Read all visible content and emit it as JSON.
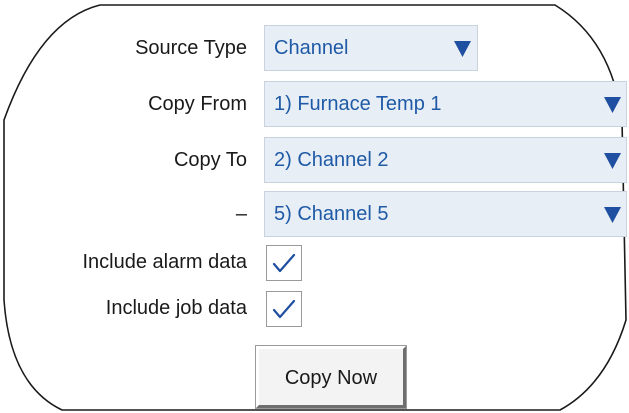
{
  "form": {
    "source_type": {
      "label": "Source Type",
      "value": "Channel"
    },
    "copy_from": {
      "label": "Copy From",
      "value": "1) Furnace Temp 1"
    },
    "copy_to": {
      "label": "Copy To",
      "value": "2) Channel 2"
    },
    "copy_to_end": {
      "label": "–",
      "value": "5) Channel 5"
    },
    "include_alarm_data": {
      "label": "Include alarm data",
      "checked": true
    },
    "include_job_data": {
      "label": "Include job data",
      "checked": true
    },
    "copy_now_label": "Copy Now"
  },
  "icons": {
    "dropdown_arrow": "triangle-down-icon",
    "check": "checkmark-icon"
  },
  "colors": {
    "field_background": "#e8eef6",
    "field_text": "#1f5aa6",
    "arrow": "#1f4fa0",
    "check": "#1f4fa0",
    "label_text": "#1a1a1a"
  }
}
